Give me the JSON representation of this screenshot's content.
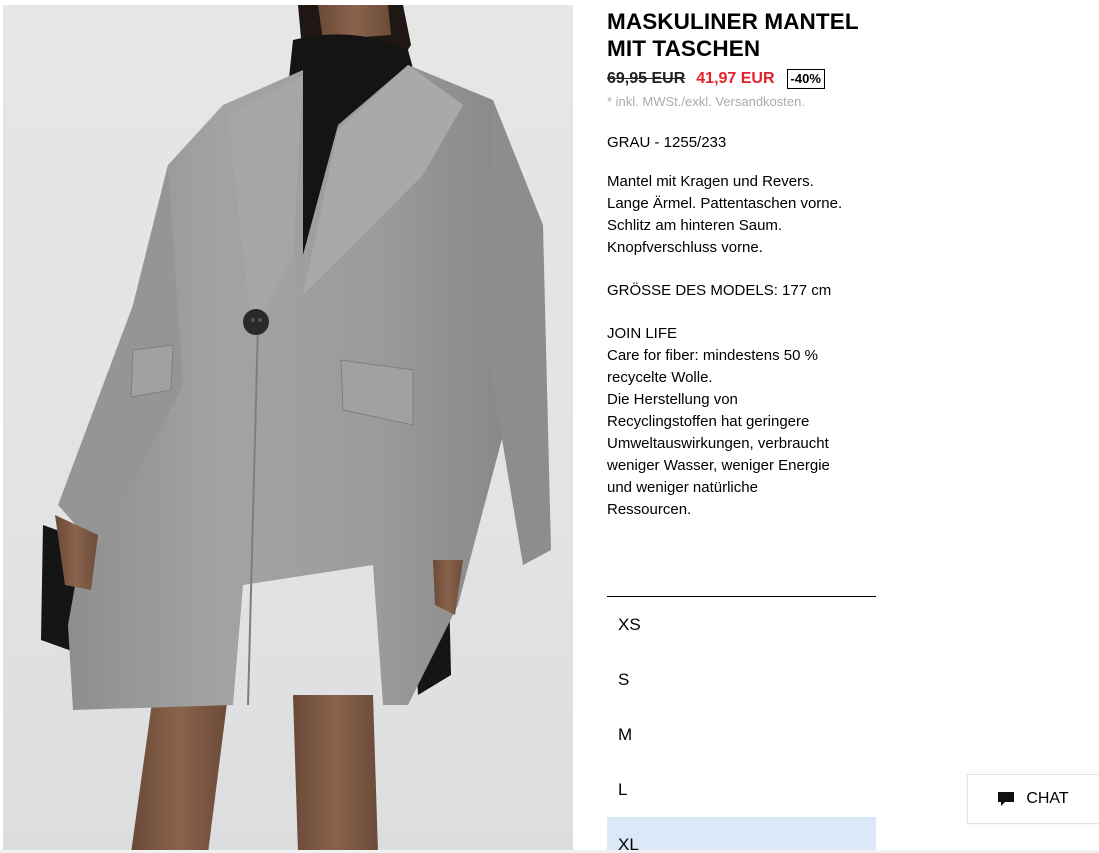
{
  "product": {
    "title": "MASKULINER MANTEL MIT TASCHEN",
    "old_price": "69,95 EUR",
    "new_price": "41,97 EUR",
    "discount": "-40%",
    "tax_note": "* inkl. MWSt./exkl. Versandkosten.",
    "color_ref": "GRAU - 1255/233",
    "description": "Mantel mit Kragen und Revers.\nLange Ärmel. Pattentaschen vorne.\nSchlitz am hinteren Saum.\nKnopfverschluss vorne.",
    "model_size": "GRÖSSE DES MODELS: 177 cm",
    "join_life": "JOIN LIFE\nCare for fiber: mindestens 50 %\nrecycelte Wolle.\nDie Herstellung von\nRecyclingstoffen hat geringere\nUmweltauswirkungen, verbraucht\nweniger Wasser, weniger Energie\nund weniger natürliche\nRessourcen."
  },
  "colors": {
    "sale_price": "#e4202a",
    "selected_size_bg": "#dbe8f8",
    "coat": "#9c9c9c"
  },
  "sizes": [
    "XS",
    "S",
    "M",
    "L",
    "XL"
  ],
  "selected_size": "XL",
  "chat": {
    "label": "CHAT",
    "icon": "chat-bubble-icon"
  }
}
